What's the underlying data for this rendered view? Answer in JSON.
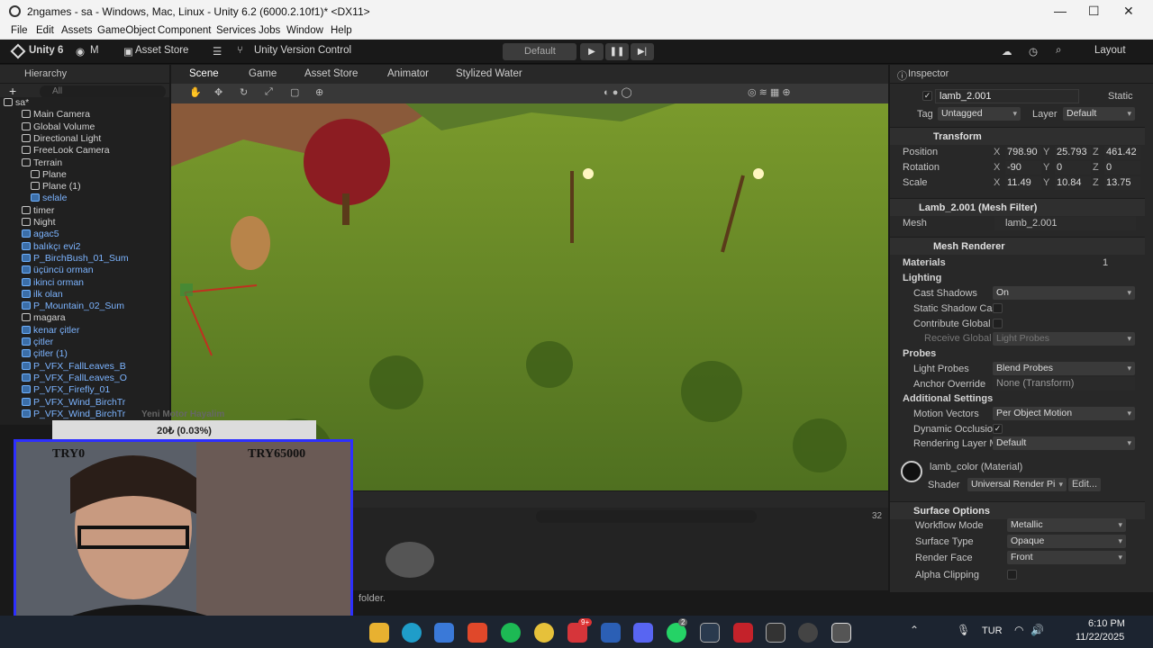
{
  "window": {
    "title": "2ngames - sa - Windows, Mac, Linux - Unity 6.2 (6000.2.10f1)* <DX11>"
  },
  "menu": [
    "File",
    "Edit",
    "Assets",
    "GameObject",
    "Component",
    "Services",
    "Jobs",
    "Window",
    "Help"
  ],
  "toolbar": {
    "unity_label": "Unity 6",
    "account": "M",
    "asset_store": "Asset Store",
    "version_control": "Unity Version Control",
    "layout_default": "Default",
    "layout": "Layout"
  },
  "hierarchy": {
    "title": "Hierarchy",
    "search_placeholder": "All",
    "items": [
      {
        "label": "sa*",
        "indent": 0,
        "blue": false
      },
      {
        "label": "Main Camera",
        "indent": 2,
        "blue": false
      },
      {
        "label": "Global Volume",
        "indent": 2,
        "blue": false
      },
      {
        "label": "Directional Light",
        "indent": 2,
        "blue": false
      },
      {
        "label": "FreeLook Camera",
        "indent": 2,
        "blue": false
      },
      {
        "label": "Terrain",
        "indent": 2,
        "blue": false
      },
      {
        "label": "Plane",
        "indent": 3,
        "blue": false
      },
      {
        "label": "Plane (1)",
        "indent": 3,
        "blue": false
      },
      {
        "label": "selale",
        "indent": 3,
        "blue": true
      },
      {
        "label": "timer",
        "indent": 2,
        "blue": false
      },
      {
        "label": "Night",
        "indent": 2,
        "blue": false
      },
      {
        "label": "agac5",
        "indent": 2,
        "blue": true
      },
      {
        "label": "balıkçı evi2",
        "indent": 2,
        "blue": true
      },
      {
        "label": "P_BirchBush_01_Sum",
        "indent": 2,
        "blue": true
      },
      {
        "label": "üçüncü orman",
        "indent": 2,
        "blue": true
      },
      {
        "label": "ikinci orman",
        "indent": 2,
        "blue": true
      },
      {
        "label": "ilk olan",
        "indent": 2,
        "blue": true
      },
      {
        "label": "P_Mountain_02_Sum",
        "indent": 2,
        "blue": true
      },
      {
        "label": "magara",
        "indent": 2,
        "blue": false
      },
      {
        "label": "kenar çitler",
        "indent": 2,
        "blue": true
      },
      {
        "label": "çitler",
        "indent": 2,
        "blue": true
      },
      {
        "label": "çitler (1)",
        "indent": 2,
        "blue": true
      },
      {
        "label": "P_VFX_FallLeaves_B",
        "indent": 2,
        "blue": true
      },
      {
        "label": "P_VFX_FallLeaves_O",
        "indent": 2,
        "blue": true
      },
      {
        "label": "P_VFX_Firefly_01",
        "indent": 2,
        "blue": true
      },
      {
        "label": "P_VFX_Wind_BirchTr",
        "indent": 2,
        "blue": true
      },
      {
        "label": "P_VFX_Wind_BirchTr",
        "indent": 2,
        "blue": true
      }
    ]
  },
  "scene_tabs": [
    "Scene",
    "Game",
    "Asset Store",
    "Animator",
    "Stylized Water"
  ],
  "inspector": {
    "title": "Inspector",
    "object_name": "lamb_2.001",
    "static_label": "Static",
    "tag_label": "Tag",
    "tag_value": "Untagged",
    "layer_label": "Layer",
    "layer_value": "Default",
    "transform": {
      "title": "Transform",
      "position": {
        "label": "Position",
        "x": "798.90",
        "y": "25.793",
        "z": "461.42"
      },
      "rotation": {
        "label": "Rotation",
        "x": "-90",
        "y": "0",
        "z": "0"
      },
      "scale": {
        "label": "Scale",
        "x": "11.49",
        "y": "10.84",
        "z": "13.75"
      }
    },
    "mesh_filter": {
      "title": "Lamb_2.001 (Mesh Filter)",
      "mesh_label": "Mesh",
      "mesh_value": "lamb_2.001"
    },
    "mesh_renderer": {
      "title": "Mesh Renderer",
      "materials_label": "Materials",
      "materials_count": "1",
      "lighting_label": "Lighting",
      "cast_shadows_label": "Cast Shadows",
      "cast_shadows_value": "On",
      "static_shadow_label": "Static Shadow Cas",
      "contribute_gi_label": "Contribute Global I",
      "receive_gi_label": "Receive Global I",
      "receive_gi_value": "Light Probes",
      "probes_label": "Probes",
      "light_probes_label": "Light Probes",
      "light_probes_value": "Blend Probes",
      "anchor_label": "Anchor Override",
      "anchor_value": "None (Transform)",
      "additional_label": "Additional Settings",
      "motion_vectors_label": "Motion Vectors",
      "motion_vectors_value": "Per Object Motion",
      "dynamic_occ_label": "Dynamic Occlusio",
      "render_layer_label": "Rendering Layer M",
      "render_layer_value": "Default"
    },
    "material": {
      "title": "lamb_color (Material)",
      "shader_label": "Shader",
      "shader_value": "Universal Render Pi",
      "edit_label": "Edit..."
    },
    "surface": {
      "title": "Surface Options",
      "workflow_label": "Workflow Mode",
      "workflow_value": "Metallic",
      "type_label": "Surface Type",
      "type_value": "Opaque",
      "face_label": "Render Face",
      "face_value": "Front",
      "alpha_label": "Alpha Clipping"
    }
  },
  "axes": {
    "x": "X",
    "y": "Y",
    "z": "Z"
  },
  "project": {
    "count": "32",
    "status_text": "folder."
  },
  "stream": {
    "donation": "20₺ (0.03%)",
    "goal_title": "Yeni Motor Hayalim",
    "left_amount": "TRY0",
    "right_amount": "TRY65000"
  },
  "taskbar": {
    "lang": "TUR",
    "time": "6:10 PM",
    "date": "11/22/2025",
    "badge1": "9+",
    "badge2": "2"
  }
}
